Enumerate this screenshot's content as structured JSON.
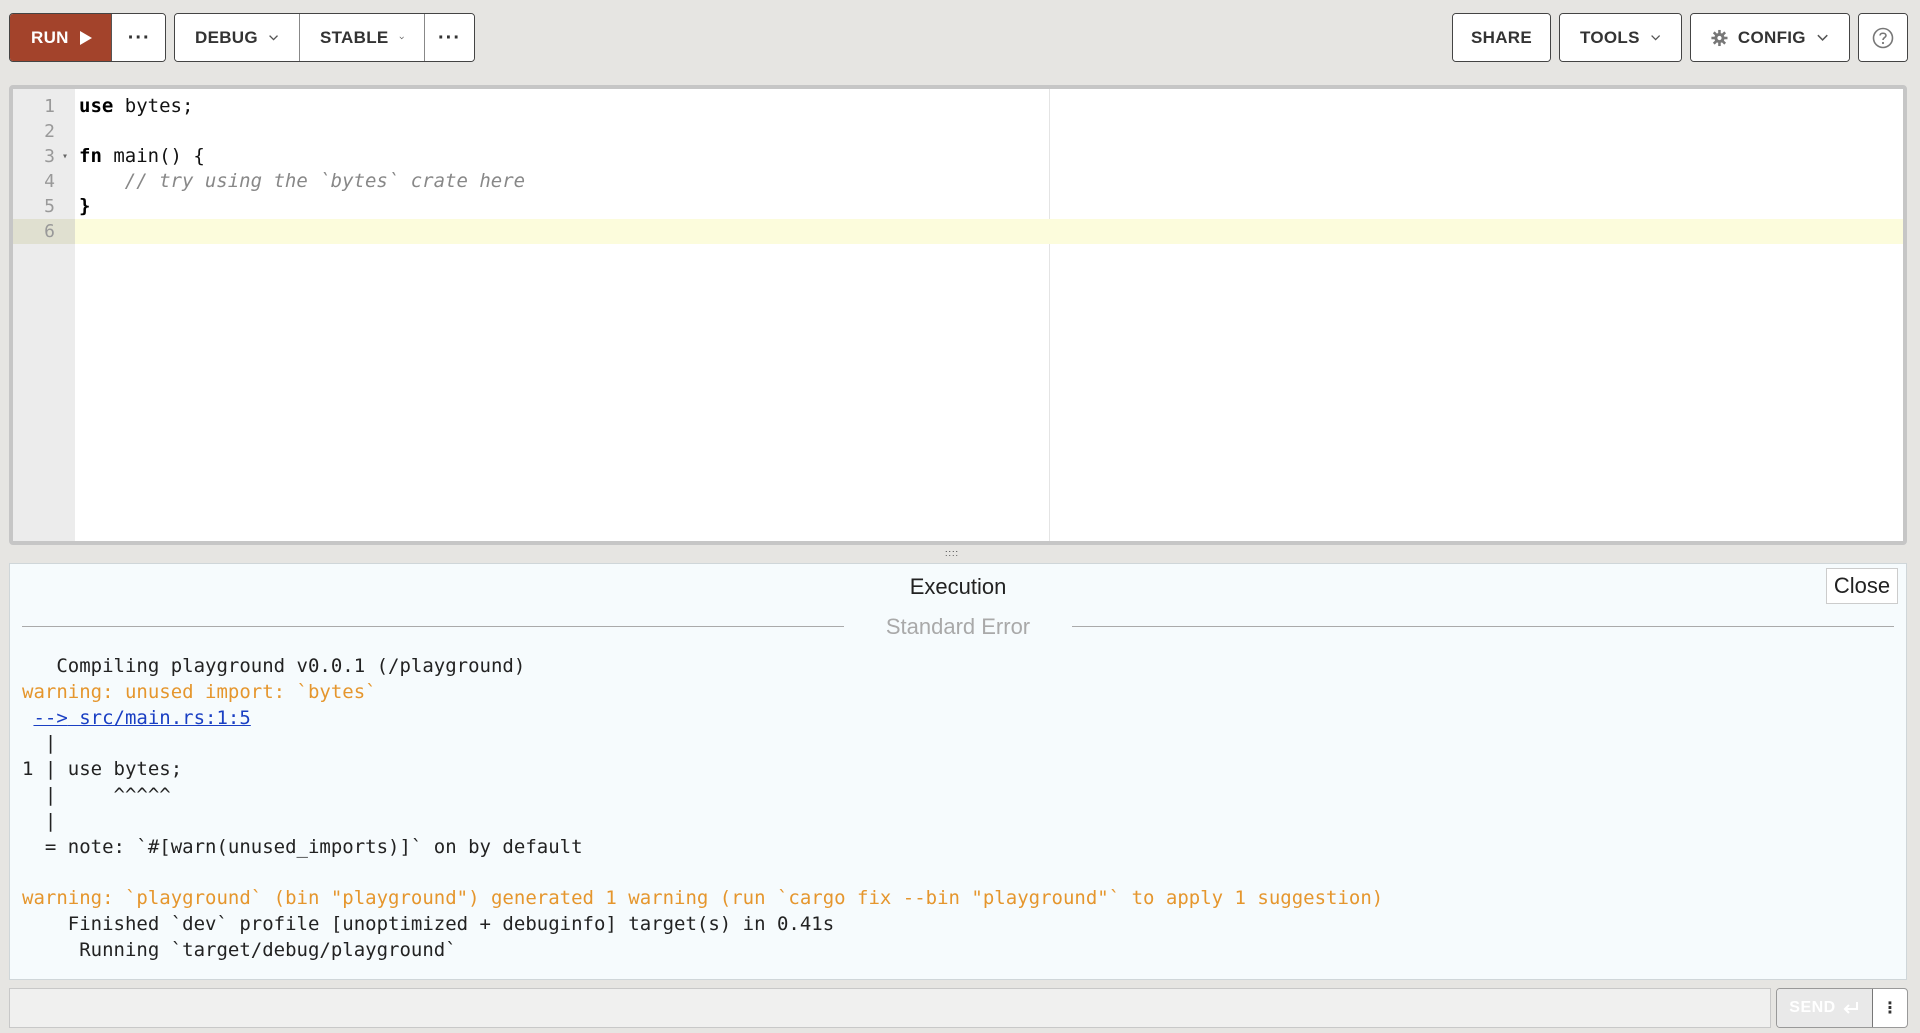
{
  "toolbar": {
    "run_label": "RUN",
    "more": "···",
    "mode_label": "DEBUG",
    "channel_label": "STABLE",
    "share_label": "SHARE",
    "tools_label": "TOOLS",
    "config_label": "CONFIG",
    "accent": "#a3432b"
  },
  "editor": {
    "lines": [
      {
        "n": "1",
        "kw": "use",
        "rest": " bytes;"
      },
      {
        "n": "2",
        "kw": "",
        "rest": ""
      },
      {
        "n": "3",
        "kw": "fn",
        "rest": " main() {"
      },
      {
        "n": "4",
        "comment": "    // try using the `bytes` crate here"
      },
      {
        "n": "5",
        "kw": "",
        "rest": "}"
      },
      {
        "n": "6",
        "kw": "",
        "rest": ""
      }
    ],
    "active_line": "6"
  },
  "output": {
    "title": "Execution",
    "close_label": "Close",
    "section": "Standard Error",
    "stderr": [
      {
        "t": "   Compiling playground v0.0.1 (/playground)",
        "s": "normal"
      },
      {
        "t": "warning: unused import: `bytes`",
        "s": "warn"
      },
      {
        "t": "-->",
        "t2": " src/main.rs:1:5",
        "s": "link"
      },
      {
        "t": "  |",
        "s": "normal"
      },
      {
        "t": "1 | use bytes;",
        "s": "normal"
      },
      {
        "t": "  |     ^^^^^",
        "s": "normal"
      },
      {
        "t": "  |",
        "s": "normal"
      },
      {
        "t": "  = note: `#[warn(unused_imports)]` on by default",
        "s": "normal"
      },
      {
        "t": "",
        "s": "normal"
      },
      {
        "t": "warning: `playground` (bin \"playground\") generated 1 warning (run `cargo fix --bin \"playground\"` to apply 1 suggestion)",
        "s": "warn"
      },
      {
        "t": "    Finished `dev` profile [unoptimized + debuginfo] target(s) in 0.41s",
        "s": "normal"
      },
      {
        "t": "     Running `target/debug/playground`",
        "s": "normal"
      }
    ]
  },
  "stdin": {
    "value": "",
    "send_label": "SEND"
  }
}
